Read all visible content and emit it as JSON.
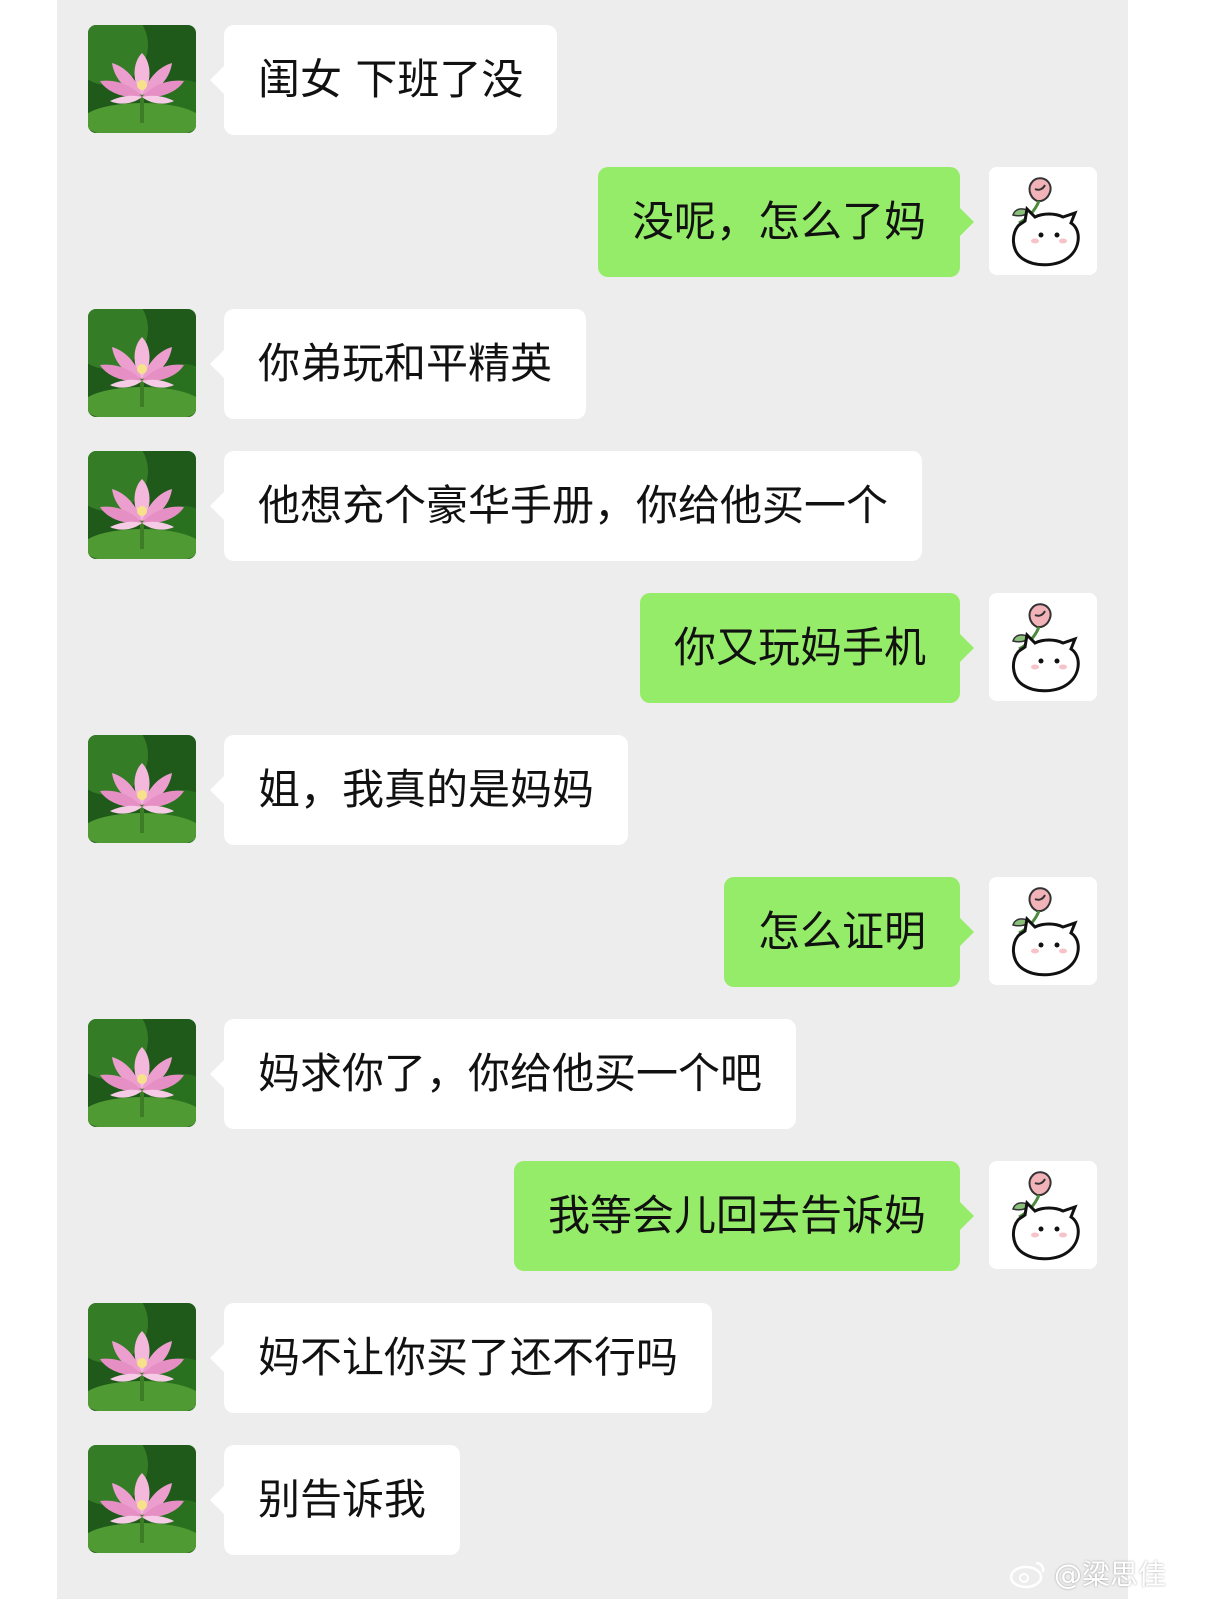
{
  "colors": {
    "chat_background": "#ededed",
    "incoming_bubble": "#ffffff",
    "outgoing_bubble": "#95ec69",
    "text": "#111111"
  },
  "contacts": {
    "mom_avatar_icon": "lotus-flower-icon",
    "me_avatar_icon": "cat-with-rose-icon"
  },
  "messages": [
    {
      "from": "mom",
      "text": "闺女 下班了没"
    },
    {
      "from": "me",
      "text": "没呢，怎么了妈"
    },
    {
      "from": "mom",
      "text": "你弟玩和平精英"
    },
    {
      "from": "mom",
      "text": "他想充个豪华手册，你给他买一个"
    },
    {
      "from": "me",
      "text": "你又玩妈手机"
    },
    {
      "from": "mom",
      "text": "姐，我真的是妈妈"
    },
    {
      "from": "me",
      "text": "怎么证明"
    },
    {
      "from": "mom",
      "text": "妈求你了，你给他买一个吧"
    },
    {
      "from": "me",
      "text": "我等会儿回去告诉妈"
    },
    {
      "from": "mom",
      "text": "妈不让你买了还不行吗"
    },
    {
      "from": "mom",
      "text": "别告诉我"
    }
  ],
  "watermark": {
    "icon": "weibo-logo-icon",
    "text": "@粱思佳"
  }
}
